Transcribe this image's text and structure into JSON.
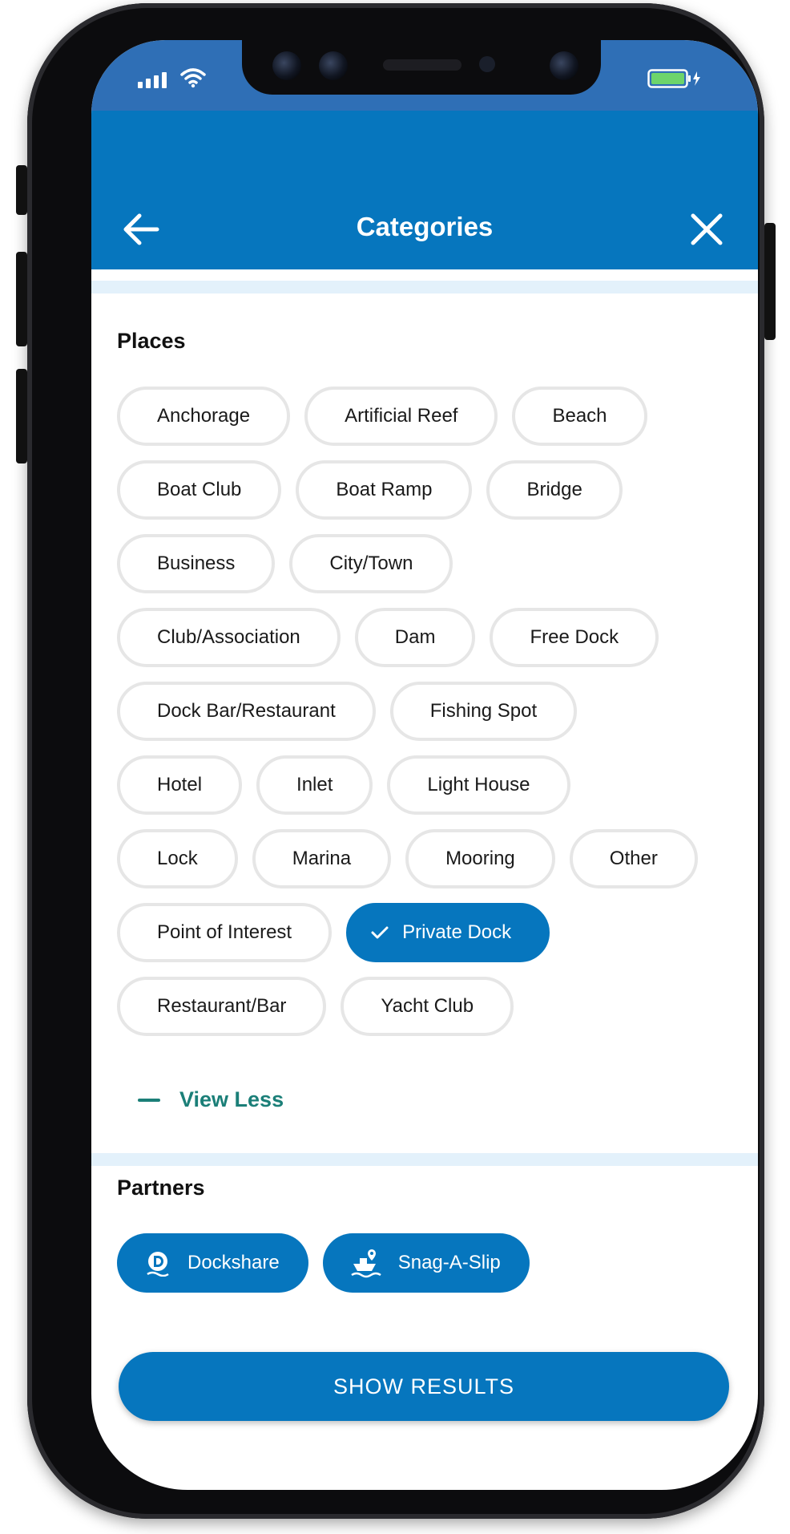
{
  "header": {
    "title": "Categories"
  },
  "places": {
    "title": "Places",
    "rows": [
      [
        {
          "label": "Anchorage"
        },
        {
          "label": "Artificial Reef"
        },
        {
          "label": "Beach"
        }
      ],
      [
        {
          "label": "Boat Club"
        },
        {
          "label": "Boat Ramp"
        },
        {
          "label": "Bridge"
        }
      ],
      [
        {
          "label": "Business"
        },
        {
          "label": "City/Town"
        }
      ],
      [
        {
          "label": "Club/Association"
        },
        {
          "label": "Dam"
        },
        {
          "label": "Free Dock"
        }
      ],
      [
        {
          "label": "Dock Bar/Restaurant"
        },
        {
          "label": "Fishing Spot"
        }
      ],
      [
        {
          "label": "Hotel"
        },
        {
          "label": "Inlet"
        },
        {
          "label": "Light House"
        }
      ],
      [
        {
          "label": "Lock"
        },
        {
          "label": "Marina"
        },
        {
          "label": "Mooring"
        },
        {
          "label": "Other"
        }
      ],
      [
        {
          "label": "Point of Interest"
        },
        {
          "label": "Private Dock",
          "selected": true
        }
      ],
      [
        {
          "label": "Restaurant/Bar"
        },
        {
          "label": "Yacht Club"
        }
      ]
    ],
    "view_less_label": "View Less"
  },
  "partners": {
    "title": "Partners",
    "items": [
      {
        "label": "Dockshare",
        "icon": "dockshare-logo-icon"
      },
      {
        "label": "Snag-A-Slip",
        "icon": "boat-pin-icon"
      }
    ]
  },
  "actions": {
    "show_results_label": "SHOW RESULTS"
  },
  "colors": {
    "primary": "#0676be",
    "status_bar": "#2f6fb6",
    "divider": "#e3f1fb",
    "view_less": "#1b7f78",
    "chip_border": "#e6e6e6",
    "battery": "#6dd46b"
  }
}
